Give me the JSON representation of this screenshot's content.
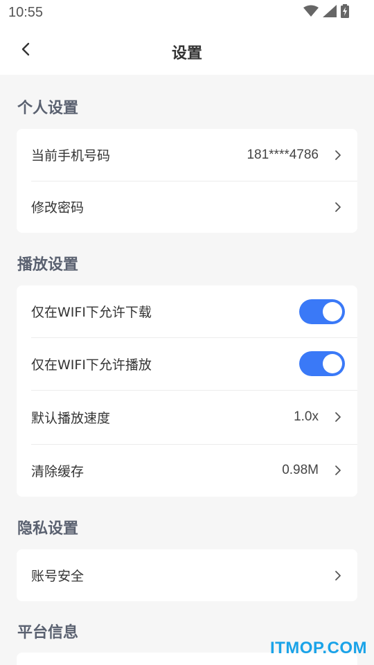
{
  "status_bar": {
    "time": "10:55",
    "icons": [
      "wifi-icon",
      "signal-icon",
      "battery-charging-icon"
    ]
  },
  "nav": {
    "title": "设置",
    "back_icon": "chevron-left-icon"
  },
  "sections": {
    "personal": {
      "title": "个人设置",
      "items": [
        {
          "label": "当前手机号码",
          "value": "181****4786"
        },
        {
          "label": "修改密码"
        }
      ]
    },
    "playback": {
      "title": "播放设置",
      "items": [
        {
          "label": "仅在WIFI下允许下载",
          "toggle": true
        },
        {
          "label": "仅在WIFI下允许播放",
          "toggle": true
        },
        {
          "label": "默认播放速度",
          "value": "1.0x"
        },
        {
          "label": "清除缓存",
          "value": "0.98M"
        }
      ]
    },
    "privacy": {
      "title": "隐私设置",
      "items": [
        {
          "label": "账号安全"
        }
      ]
    },
    "platform": {
      "title": "平台信息"
    }
  },
  "colors": {
    "accent": "#3a79f7",
    "section_title": "#5a6170",
    "background": "#f6f6f6"
  },
  "watermark": "ITMOP.COM"
}
